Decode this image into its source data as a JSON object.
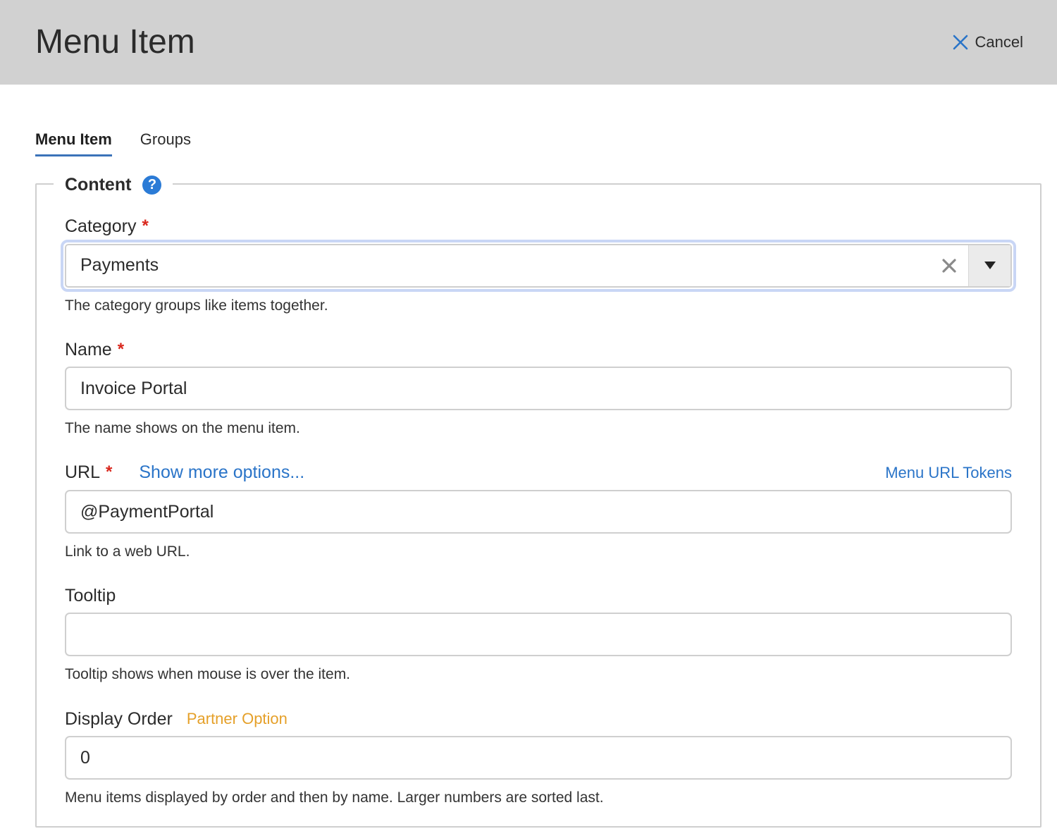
{
  "header": {
    "title": "Menu Item",
    "cancel_label": "Cancel"
  },
  "tabs": [
    {
      "label": "Menu Item",
      "active": true
    },
    {
      "label": "Groups",
      "active": false
    }
  ],
  "section": {
    "legend": "Content",
    "help_icon_glyph": "?"
  },
  "fields": {
    "category": {
      "label": "Category",
      "required": "*",
      "value": "Payments",
      "help": "The category groups like items together."
    },
    "name": {
      "label": "Name",
      "required": "*",
      "value": "Invoice Portal",
      "help": "The name shows on the menu item."
    },
    "url": {
      "label": "URL",
      "required": "*",
      "show_more": "Show more options...",
      "tokens_link": "Menu URL Tokens",
      "value": "@PaymentPortal",
      "help": "Link to a web URL."
    },
    "tooltip": {
      "label": "Tooltip",
      "value": "",
      "help": "Tooltip shows when mouse is over the item."
    },
    "display_order": {
      "label": "Display Order",
      "badge": "Partner Option",
      "value": "0",
      "help": "Menu items displayed by order and then by name. Larger numbers are sorted last."
    }
  },
  "colors": {
    "header_bg": "#d1d1d1",
    "accent": "#3b73b9",
    "link": "#2a74c8",
    "required": "#d9271d",
    "partner": "#e5a029",
    "focus_ring": "#c9d6f5"
  }
}
